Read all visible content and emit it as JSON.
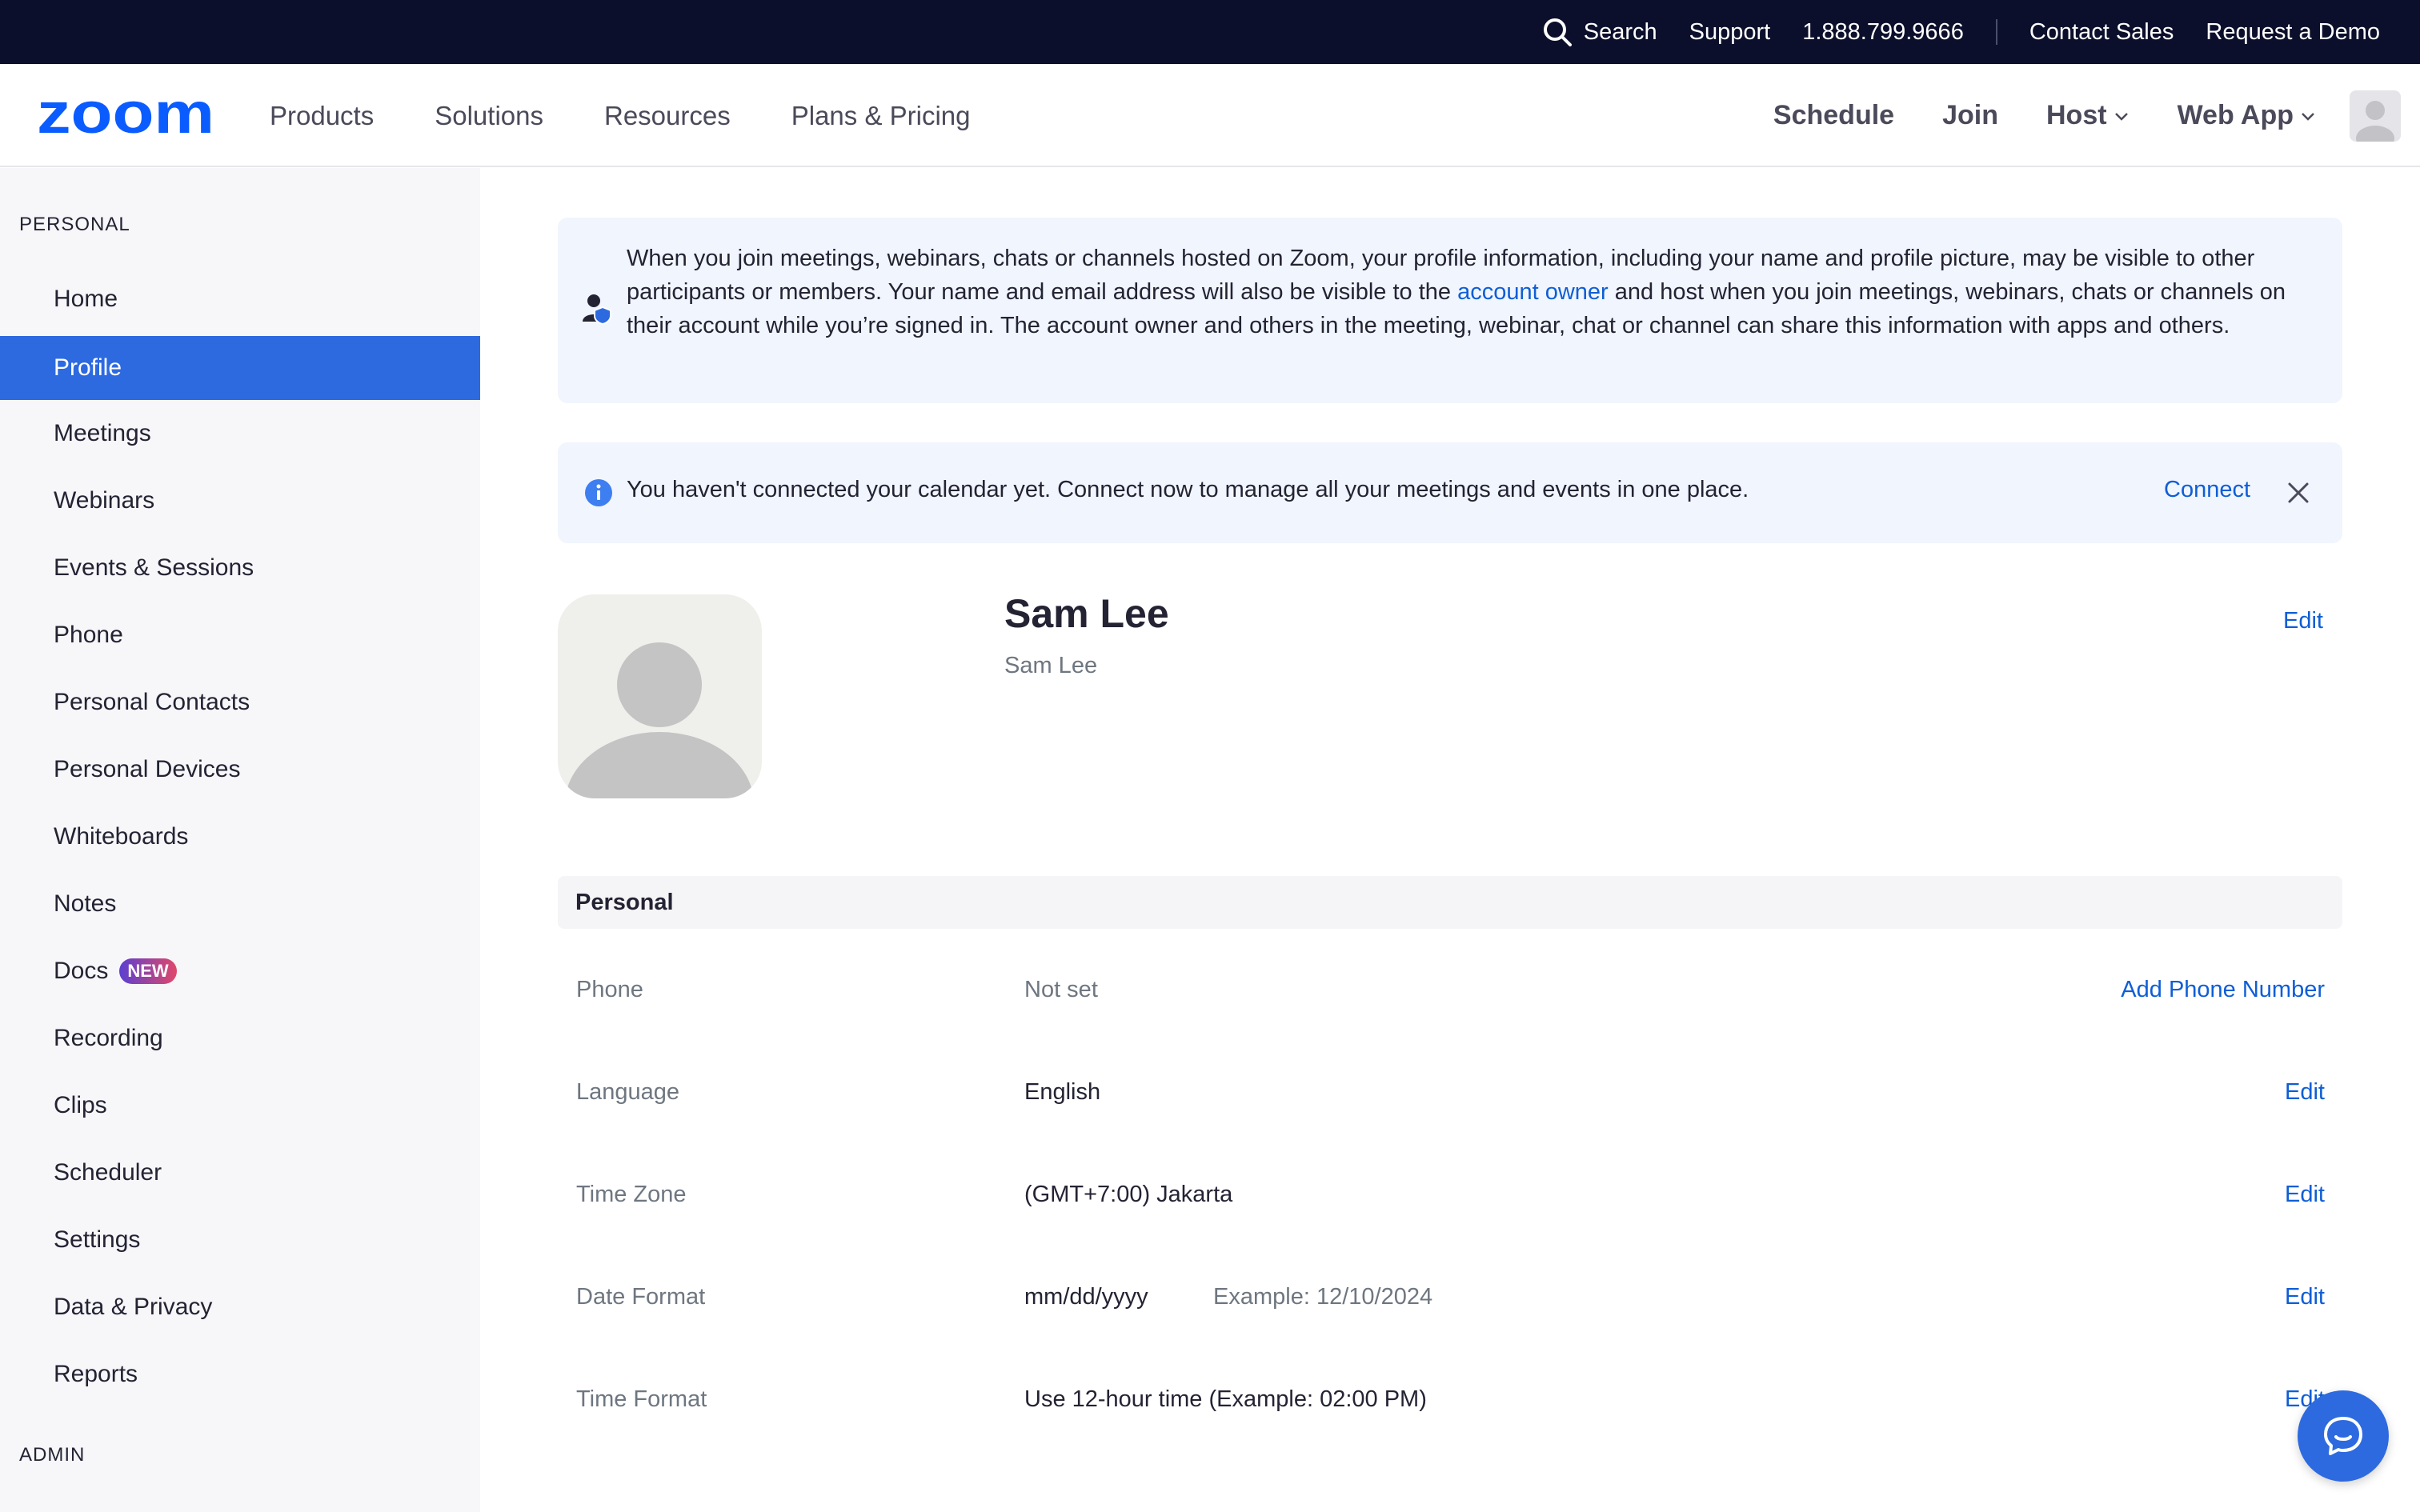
{
  "topbar": {
    "search_label": "Search",
    "support_label": "Support",
    "phone": "1.888.799.9666",
    "contact_sales": "Contact Sales",
    "request_demo": "Request a Demo"
  },
  "nav": {
    "logo_text": "zoom",
    "brand_color": "#0b5cff",
    "left": [
      "Products",
      "Solutions",
      "Resources",
      "Plans & Pricing"
    ],
    "schedule": "Schedule",
    "join": "Join",
    "host": "Host",
    "web_app": "Web App"
  },
  "sidebar": {
    "personal_heading": "PERSONAL",
    "admin_heading": "ADMIN",
    "items": [
      {
        "label": "Home"
      },
      {
        "label": "Profile"
      },
      {
        "label": "Meetings"
      },
      {
        "label": "Webinars"
      },
      {
        "label": "Events & Sessions"
      },
      {
        "label": "Phone"
      },
      {
        "label": "Personal Contacts"
      },
      {
        "label": "Personal Devices"
      },
      {
        "label": "Whiteboards"
      },
      {
        "label": "Notes"
      },
      {
        "label": "Docs"
      },
      {
        "label": "Recording"
      },
      {
        "label": "Clips"
      },
      {
        "label": "Scheduler"
      },
      {
        "label": "Settings"
      },
      {
        "label": "Data & Privacy"
      },
      {
        "label": "Reports"
      }
    ],
    "active_item": "Profile",
    "docs_badge": "NEW",
    "active_color": "#2d6ae0"
  },
  "notice": {
    "text_before": "When you join meetings, webinars, chats or channels hosted on Zoom, your profile information, including your name and profile picture, may be visible to other participants or members. Your name and email address will also be visible to the ",
    "link_text": "account owner",
    "text_after": " and host when you join meetings, webinars, chats or channels on their account while you’re signed in. The account owner and others in the meeting, webinar, chat or channel can share this information with apps and others."
  },
  "calendar_banner": {
    "text": "You haven't connected your calendar yet. Connect now to manage all your meetings and events in one place.",
    "connect_label": "Connect"
  },
  "profile": {
    "name": "Sam Lee",
    "display_name": "Sam Lee",
    "edit_label": "Edit"
  },
  "personal_section": {
    "heading": "Personal",
    "rows": [
      {
        "label": "Phone",
        "value": "Not set",
        "action": "Add Phone Number"
      },
      {
        "label": "Language",
        "value": "English",
        "action": "Edit"
      },
      {
        "label": "Time Zone",
        "value": "(GMT+7:00) Jakarta",
        "action": "Edit"
      },
      {
        "label": "Date Format",
        "value": "mm/dd/yyyy",
        "extra": "Example: 12/10/2024",
        "action": "Edit"
      },
      {
        "label": "Time Format",
        "value": "Use 12-hour time (Example: 02:00 PM)",
        "action": "Edit"
      }
    ]
  }
}
